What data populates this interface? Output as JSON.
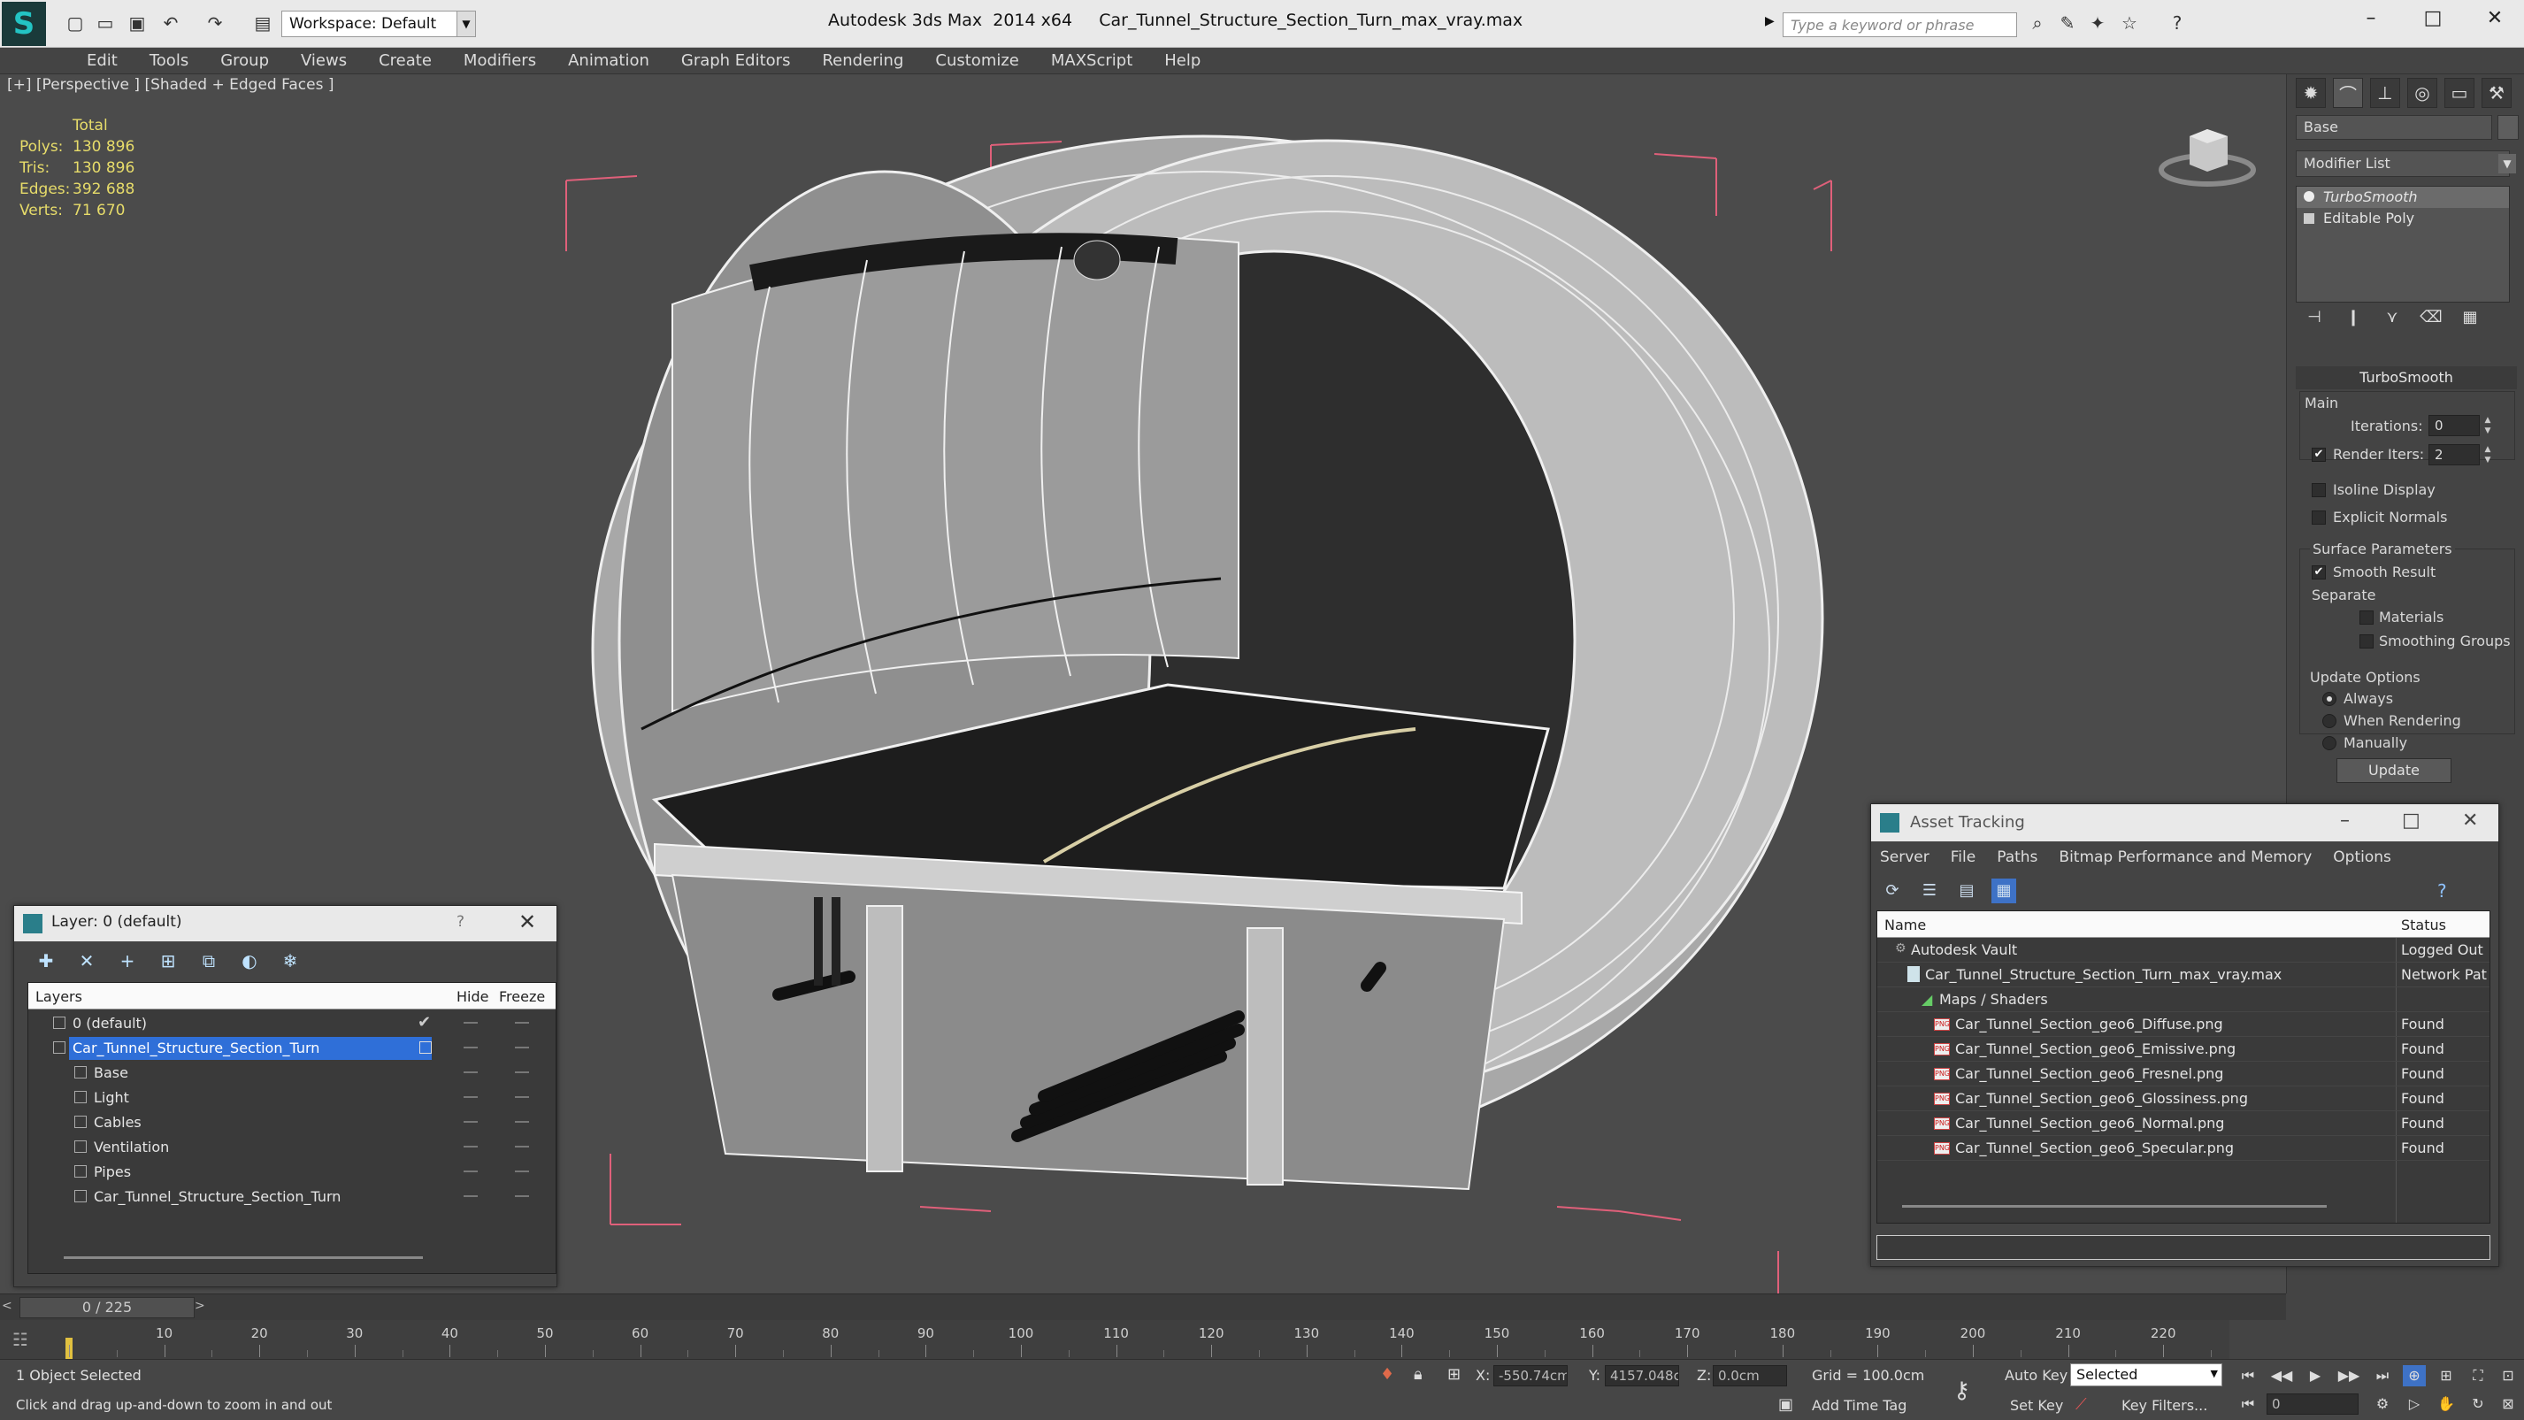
{
  "titlebar": {
    "workspace": "Workspace: Default",
    "app_title": "Autodesk 3ds Max  2014 x64     Car_Tunnel_Structure_Section_Turn_max_vray.max",
    "search_placeholder": "Type a keyword or phrase",
    "minimize": "–",
    "maximize": "□",
    "close": "✕"
  },
  "menu": [
    "Edit",
    "Tools",
    "Group",
    "Views",
    "Create",
    "Modifiers",
    "Animation",
    "Graph Editors",
    "Rendering",
    "Customize",
    "MAXScript",
    "Help"
  ],
  "viewport": {
    "label": "[+] [Perspective ] [Shaded + Edged Faces ]",
    "stats": {
      "total_label": "Total",
      "rows": [
        {
          "key": "Polys:",
          "value": "130 896"
        },
        {
          "key": "Tris:",
          "value": "130 896"
        },
        {
          "key": "Edges:",
          "value": "392 688"
        },
        {
          "key": "Verts:",
          "value": "71 670"
        }
      ]
    }
  },
  "command_panel": {
    "object_name": "Base",
    "modifier_list": "Modifier List",
    "stack": [
      "TurboSmooth",
      "Editable Poly"
    ],
    "turbosmooth": {
      "title": "TurboSmooth",
      "main": "Main",
      "iterations_label": "Iterations:",
      "iterations_value": "0",
      "render_iters_label": "Render Iters:",
      "render_iters_value": "2",
      "render_iters_checked": "✔",
      "isoline": "Isoline Display",
      "explicit_normals": "Explicit Normals",
      "surface_params": "Surface Parameters",
      "smooth_result": "Smooth Result",
      "smooth_result_checked": "✔",
      "separate": "Separate",
      "materials": "Materials",
      "smoothing_groups": "Smoothing Groups",
      "update_options": "Update Options",
      "always": "Always",
      "when_rendering": "When Rendering",
      "manually": "Manually",
      "update_button": "Update"
    }
  },
  "layer_dialog": {
    "title": "Layer: 0 (default)",
    "help": "?",
    "close": "✕",
    "col_layers": "Layers",
    "col_hide": "Hide",
    "col_freeze": "Freeze",
    "rows": [
      {
        "name": "0 (default)"
      },
      {
        "name": "Car_Tunnel_Structure_Section_Turn"
      },
      {
        "name": "Base"
      },
      {
        "name": "Light"
      },
      {
        "name": "Cables"
      },
      {
        "name": "Ventilation"
      },
      {
        "name": "Pipes"
      },
      {
        "name": "Car_Tunnel_Structure_Section_Turn"
      }
    ],
    "default_check": "✔"
  },
  "asset_tracking": {
    "title": "Asset Tracking",
    "menu": [
      "Server",
      "File",
      "Paths",
      "Bitmap Performance and Memory",
      "Options"
    ],
    "col_name": "Name",
    "col_status": "Status",
    "rows": [
      {
        "name": "Autodesk Vault",
        "status": "Logged Out"
      },
      {
        "name": "Car_Tunnel_Structure_Section_Turn_max_vray.max",
        "status": "Network Pat"
      },
      {
        "name": "Maps / Shaders",
        "status": ""
      },
      {
        "name": "Car_Tunnel_Section_geo6_Diffuse.png",
        "status": "Found"
      },
      {
        "name": "Car_Tunnel_Section_geo6_Emissive.png",
        "status": "Found"
      },
      {
        "name": "Car_Tunnel_Section_geo6_Fresnel.png",
        "status": "Found"
      },
      {
        "name": "Car_Tunnel_Section_geo6_Glossiness.png",
        "status": "Found"
      },
      {
        "name": "Car_Tunnel_Section_geo6_Normal.png",
        "status": "Found"
      },
      {
        "name": "Car_Tunnel_Section_geo6_Specular.png",
        "status": "Found"
      }
    ],
    "png_badge": "PNG"
  },
  "timeline": {
    "position": "0 / 225",
    "prev": "<",
    "next": ">",
    "ticks": [
      "10",
      "20",
      "30",
      "40",
      "50",
      "60",
      "70",
      "80",
      "90",
      "100",
      "110",
      "120",
      "130",
      "140",
      "150",
      "160",
      "170",
      "180",
      "190",
      "200",
      "210",
      "220"
    ]
  },
  "statusbar": {
    "selected": "1 Object Selected",
    "prompt": "Click and drag up-and-down to zoom in and out",
    "x_label": "X:",
    "x_value": "-550.74cm",
    "y_label": "Y:",
    "y_value": "4157.048c",
    "z_label": "Z:",
    "z_value": "0.0cm",
    "grid": "Grid = 100.0cm",
    "add_time_tag": "Add Time Tag",
    "auto_key": "Auto Key",
    "set_key": "Set Key",
    "selected_dropdown": "Selected",
    "key_filters": "Key Filters...",
    "frame": "0"
  },
  "colors": {
    "selection_blue": "#2f6fd8",
    "stats_yellow": "#e7dc6a",
    "bounding_box_pink": "#e0607a"
  }
}
